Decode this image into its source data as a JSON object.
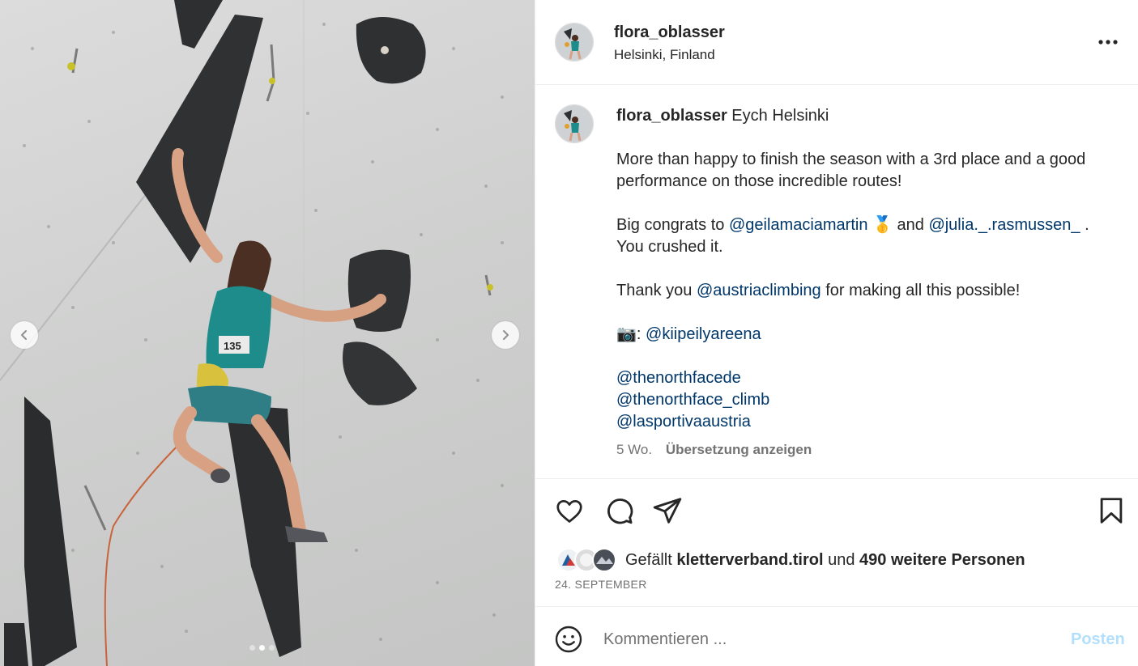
{
  "post": {
    "username": "flora_oblasser",
    "location": "Helsinki, Finland"
  },
  "caption": {
    "username": "flora_oblasser",
    "title": "Eych Helsinki",
    "line1": "More than happy to finish the season with a 3rd place and a good performance on those incredible routes!",
    "congrats_prefix": "Big congrats to",
    "mention_1": "@geilamaciamartin",
    "medal_emoji": "🥇",
    "and_word": "and",
    "mention_2": "@julia._.rasmussen_",
    "congrats_suffix": ".",
    "crushed": "You crushed it.",
    "thanks_prefix": "Thank you",
    "mention_3": "@austriaclimbing",
    "thanks_suffix": "for making all this possible!",
    "camera_emoji": "📷",
    "camera_sep": ":",
    "mention_4": "@kiipeilyareena",
    "mention_5": "@thenorthfacede",
    "mention_6": "@thenorthface_climb",
    "mention_7": "@lasportivaaustria",
    "age": "5 Wo.",
    "translate_label": "Übersetzung anzeigen"
  },
  "likes": {
    "prefix": "Gefällt",
    "liker": "kletterverband.tirol",
    "connector": "und",
    "others": "490 weitere Personen",
    "date": "24. SEPTEMBER"
  },
  "comment": {
    "placeholder": "Kommentieren ...",
    "post_label": "Posten"
  },
  "carousel": {
    "slide_count": 3,
    "active_slide": 2
  },
  "colors": {
    "mention": "#00376b",
    "post_button_disabled": "#b2dffc",
    "secondary_text": "#737373"
  },
  "icons": {
    "more": "more-horizontal-icon",
    "like": "heart-icon",
    "comment": "comment-bubble-icon",
    "share": "paper-plane-icon",
    "save": "bookmark-icon",
    "emoji": "smiley-icon",
    "prev": "chevron-left-icon",
    "next": "chevron-right-icon"
  }
}
